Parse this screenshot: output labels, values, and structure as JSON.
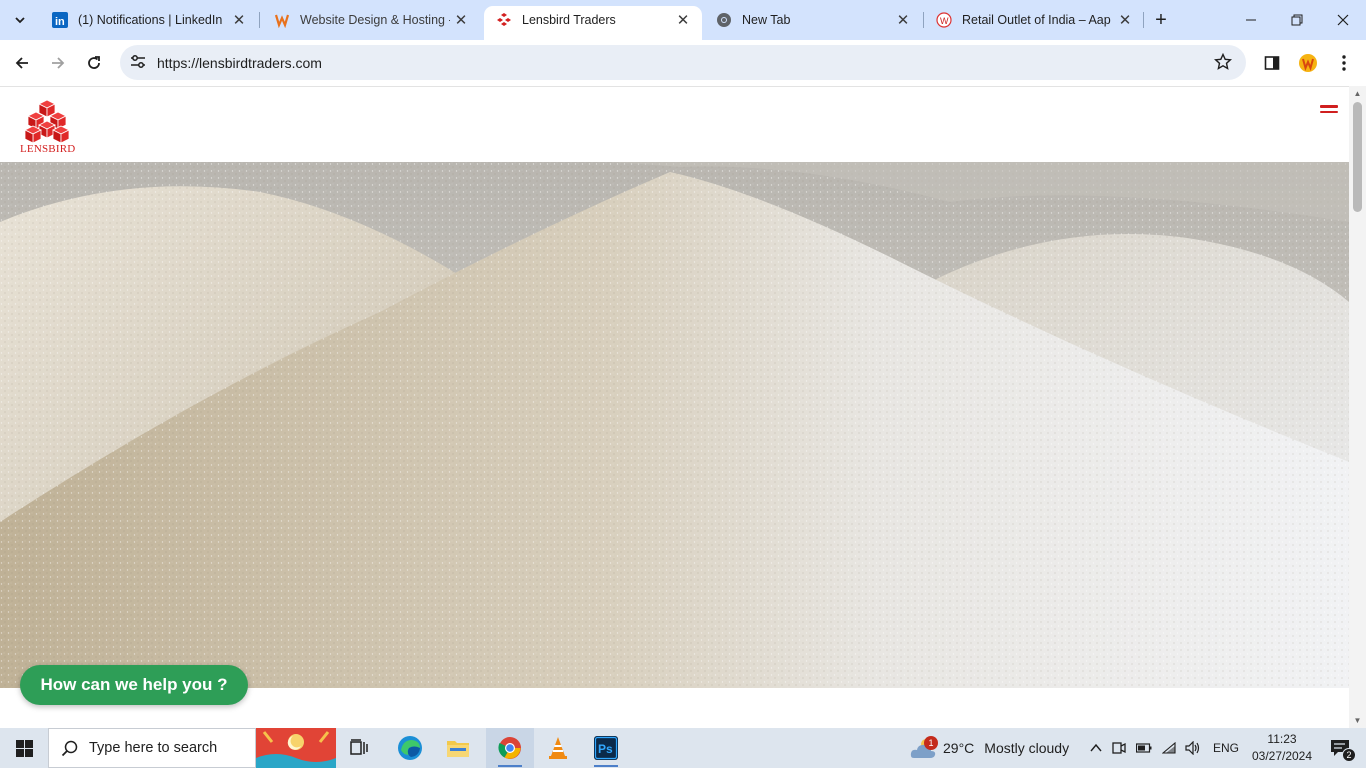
{
  "browser": {
    "tabs": [
      {
        "title": "(1) Notifications | LinkedIn",
        "favicon": "linkedin-icon"
      },
      {
        "title": "Website Design & Hosting -",
        "favicon": "hosting-icon"
      },
      {
        "title": "Lensbird Traders",
        "favicon": "lensbird-icon",
        "active": true
      },
      {
        "title": "New Tab",
        "favicon": "chrome-icon"
      },
      {
        "title": "Retail Outlet of India – Aap",
        "favicon": "retail-icon"
      }
    ],
    "url": "https://lensbirdtraders.com"
  },
  "site": {
    "logo_text": "LENSBIRD",
    "help_button": "How can we help you ?",
    "brand_color": "#d32020",
    "help_color": "#2e9e57"
  },
  "taskbar": {
    "search_placeholder": "Type here to search",
    "weather_temp": "29°C",
    "weather_desc": "Mostly cloudy",
    "weather_badge": "1",
    "language": "ENG",
    "time": "11:23",
    "date": "03/27/2024",
    "notifications": "2"
  }
}
